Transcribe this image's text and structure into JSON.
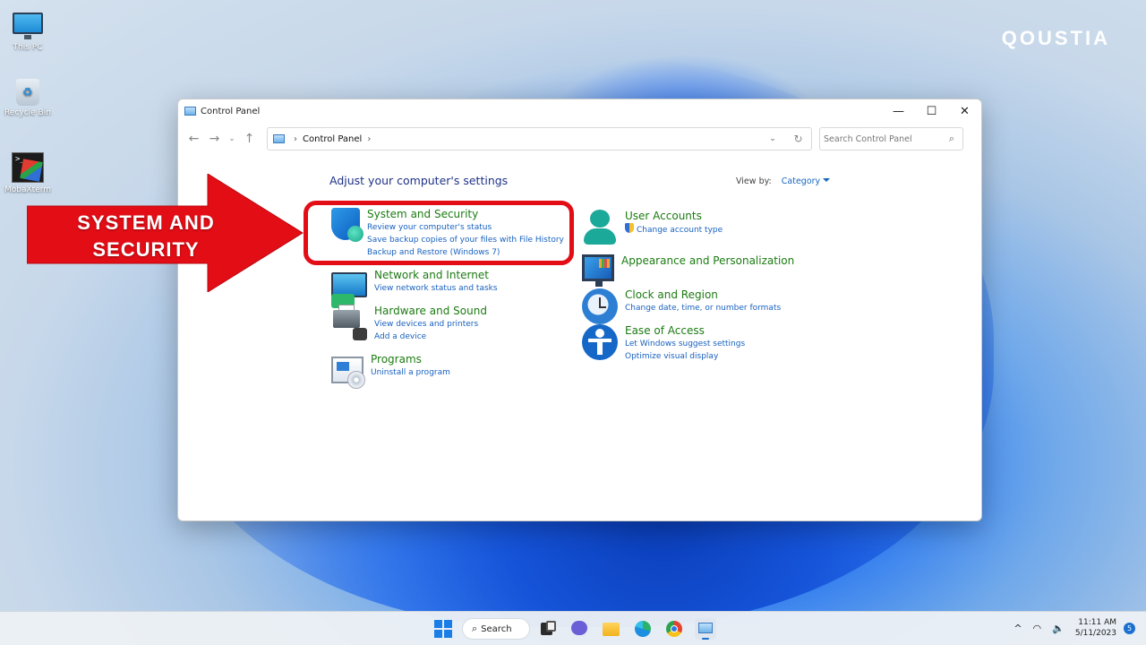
{
  "desktop": {
    "icons": [
      {
        "label": "This PC",
        "icon": "computer-icon"
      },
      {
        "label": "Recycle Bin",
        "icon": "recycle-bin-icon"
      },
      {
        "label": "MobaXterm",
        "icon": "mobaxterm-icon"
      }
    ],
    "brand": "QOUSTIA"
  },
  "window": {
    "title": "Control Panel",
    "controls": {
      "minimize": "—",
      "maximize": "☐",
      "close": "✕"
    },
    "nav": {
      "back": "←",
      "forward": "→",
      "recent": "⌄",
      "up": "↑"
    },
    "address": {
      "separator": "›",
      "location": "Control Panel",
      "trail_separator": "›",
      "dropdown": "⌄",
      "refresh": "↻"
    },
    "search": {
      "placeholder": "Search Control Panel",
      "value": ""
    }
  },
  "content": {
    "heading": "Adjust your computer's settings",
    "view_by": {
      "label": "View by:",
      "value": "Category"
    },
    "categories_left": [
      {
        "title": "System and Security",
        "icon": "shield-icon",
        "links": [
          "Review your computer's status",
          "Save backup copies of your files with File History",
          "Backup and Restore (Windows 7)"
        ]
      },
      {
        "title": "Network and Internet",
        "icon": "network-icon",
        "links": [
          "View network status and tasks"
        ]
      },
      {
        "title": "Hardware and Sound",
        "icon": "printer-icon",
        "links": [
          "View devices and printers",
          "Add a device"
        ]
      },
      {
        "title": "Programs",
        "icon": "programs-icon",
        "links": [
          "Uninstall a program"
        ]
      }
    ],
    "categories_right": [
      {
        "title": "User Accounts",
        "icon": "user-icon",
        "links": [
          "Change account type"
        ]
      },
      {
        "title": "Appearance and Personalization",
        "icon": "monitor-icon",
        "links": []
      },
      {
        "title": "Clock and Region",
        "icon": "clock-icon",
        "links": [
          "Change date, time, or number formats"
        ]
      },
      {
        "title": "Ease of Access",
        "icon": "accessibility-icon",
        "links": [
          "Let Windows suggest settings",
          "Optimize visual display"
        ]
      }
    ]
  },
  "annotation": {
    "line1": "SYSTEM AND",
    "line2": "SECURITY",
    "color": "#e30d16"
  },
  "taskbar": {
    "search_label": "Search",
    "apps": [
      "start-icon",
      "task-view-icon",
      "teams-chat-icon",
      "file-explorer-icon",
      "edge-icon",
      "chrome-icon",
      "control-panel-icon"
    ],
    "tray": {
      "chevron": "^",
      "wifi": "wifi-icon",
      "volume": "speaker-icon"
    },
    "time": "11:11 AM",
    "date": "5/11/2023",
    "notifications": "5"
  },
  "colors": {
    "category_title": "#1c7b12",
    "link": "#1861bf",
    "heading": "#1e3287",
    "highlight": "#e30d16"
  }
}
